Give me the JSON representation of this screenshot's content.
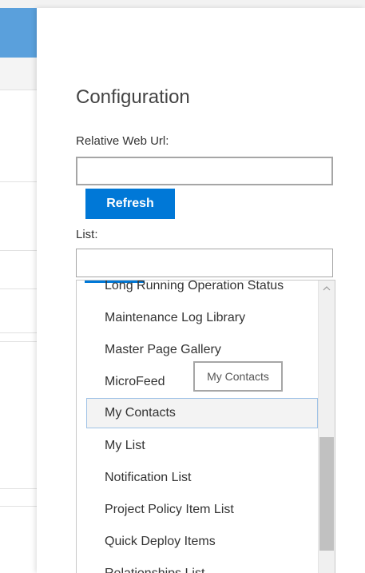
{
  "panel": {
    "title": "Configuration",
    "relative_web_url_label": "Relative Web Url:",
    "relative_web_url_value": "",
    "refresh_label": "Refresh",
    "list_label": "List:",
    "list_value": ""
  },
  "dropdown": {
    "items": [
      "Long Running Operation Status",
      "Maintenance Log Library",
      "Master Page Gallery",
      "MicroFeed",
      "My Contacts",
      "My List",
      "Notification List",
      "Project Policy Item List",
      "Quick Deploy Items",
      "Relationships List"
    ],
    "hovered_item": "My Contacts"
  },
  "tooltip": {
    "text": "My Contacts"
  },
  "colors": {
    "accent": "#0078d7",
    "header_blue": "#5aa0dc",
    "hover_bg": "#f3f3f3",
    "hover_border": "#9fc2e6"
  },
  "icons": {
    "scroll_up": "chevron-up-icon"
  }
}
